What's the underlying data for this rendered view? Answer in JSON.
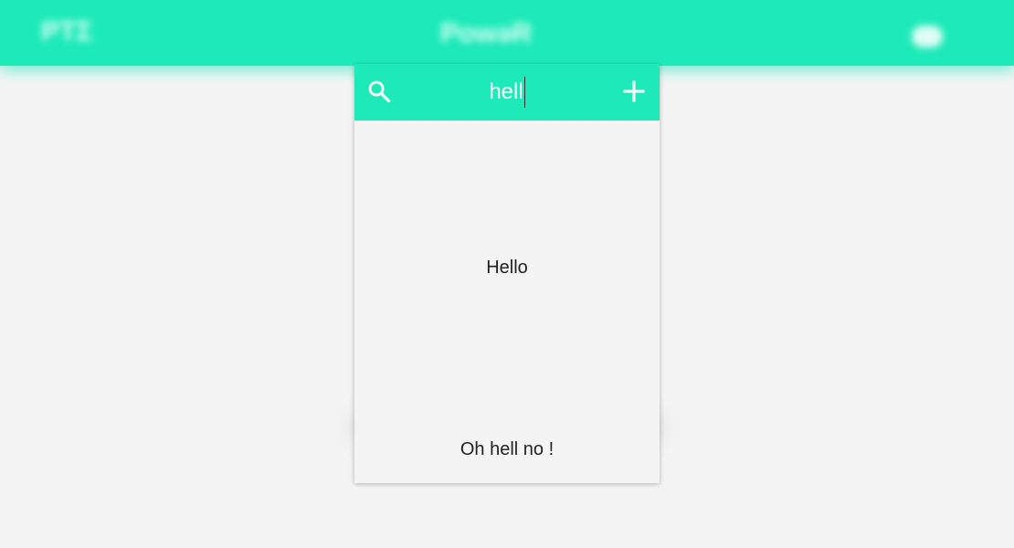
{
  "background": {
    "left_text": "ΡΤΣ",
    "center_text": "PowəR"
  },
  "search": {
    "query": "hell"
  },
  "results": [
    {
      "label": "Hello"
    },
    {
      "label": "Oh hell no !"
    }
  ],
  "icons": {
    "search": "search-icon",
    "add": "plus-icon"
  },
  "colors": {
    "accent": "#1eeab9",
    "background": "#f4f4f4",
    "text": "#222222"
  }
}
